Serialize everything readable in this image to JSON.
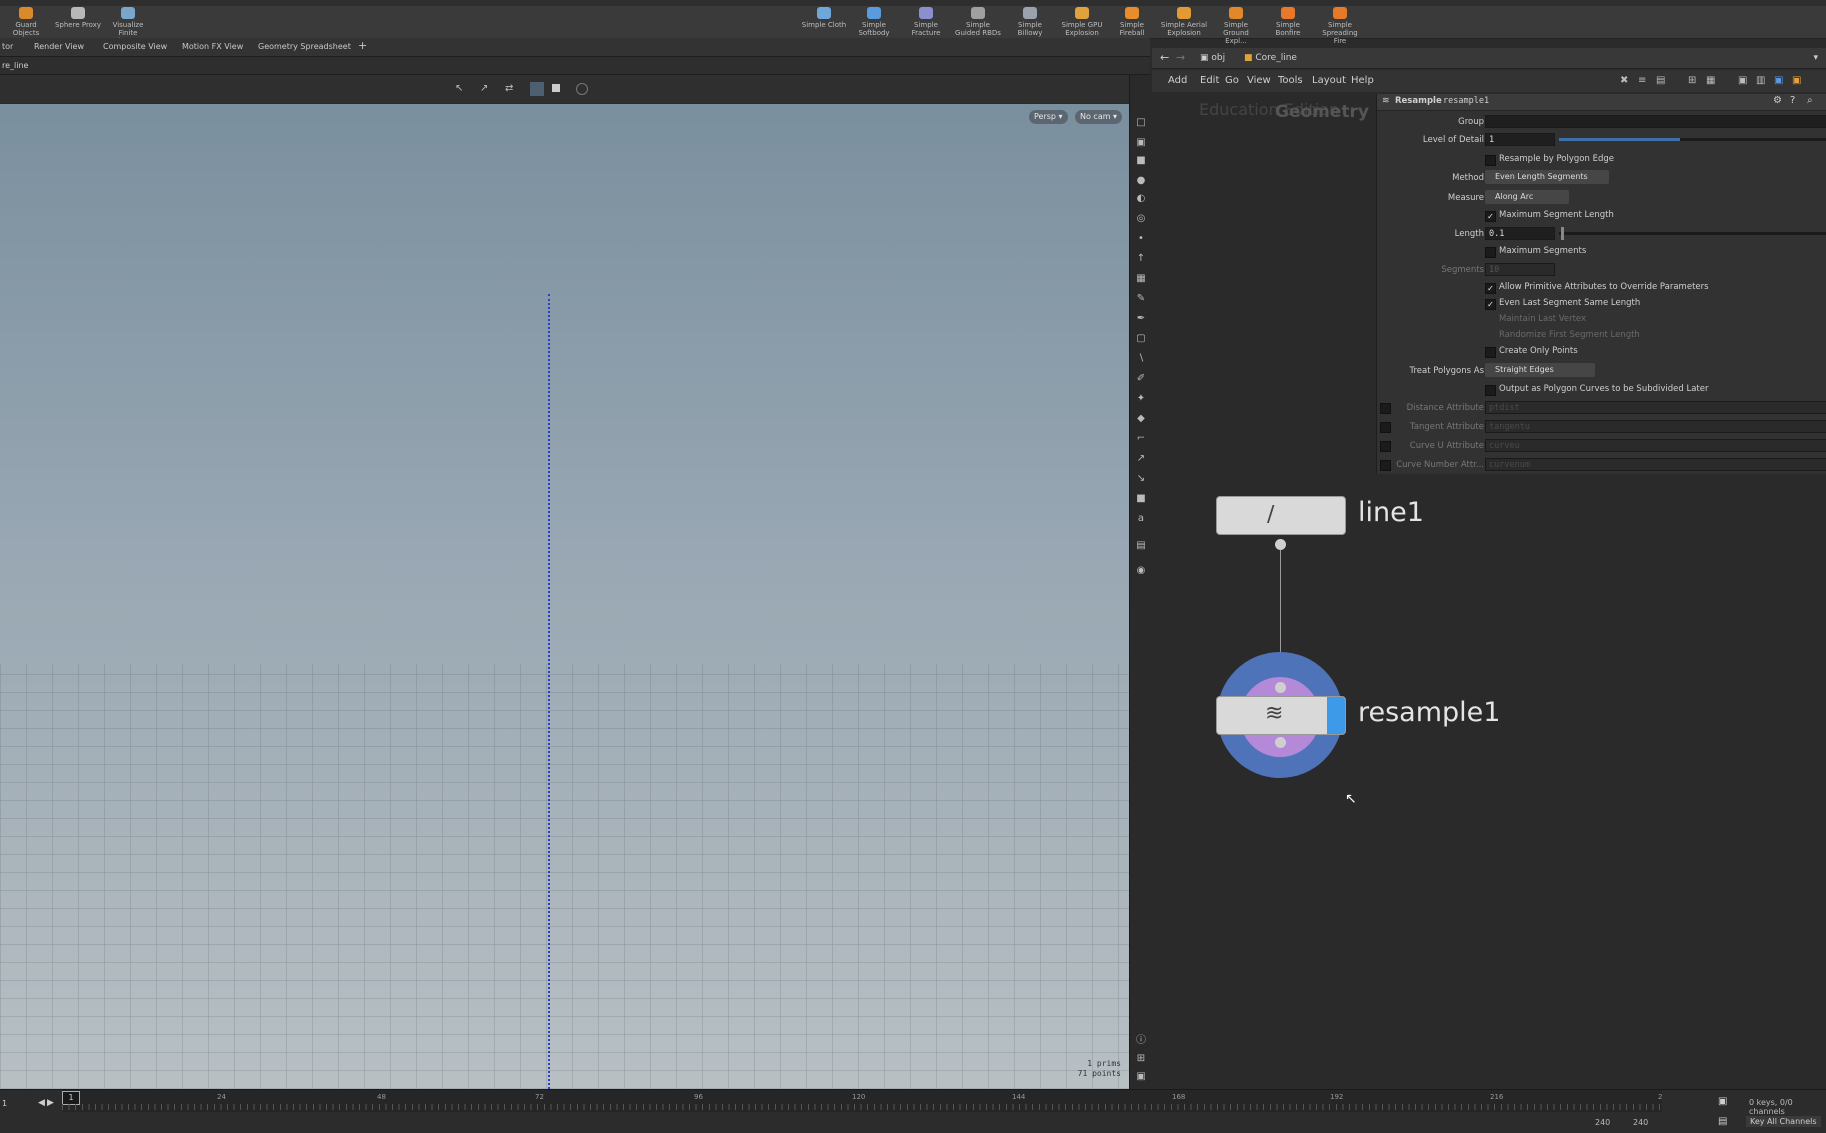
{
  "shelf": {
    "tools_left": [
      "Guard Objects",
      "Sphere Proxy",
      "Visualize Finite Eleme..."
    ],
    "tools_right": [
      "Simple Cloth",
      "Simple Softbody",
      "Simple Fracture",
      "Simple Guided RBDs",
      "Simple Billowy Smo...",
      "Simple GPU Explosion",
      "Simple Fireball",
      "Simple Aerial Explosion",
      "Simple Ground Expl...",
      "Simple Bonfire",
      "Simple Spreading Fire"
    ]
  },
  "pane_tabs": [
    "tor",
    "Render View",
    "Composite View",
    "Motion FX View",
    "Geometry Spreadsheet"
  ],
  "viewport": {
    "path": "re_line",
    "persp_button": "Persp ▾",
    "cam_button": "No cam ▾",
    "stats_prims": "1  prims",
    "stats_points": "71 points"
  },
  "network": {
    "path_obj": "obj",
    "path_node": "Core_line",
    "menu": [
      "Add",
      "Edit",
      "Go",
      "View",
      "Tools",
      "Layout",
      "Help"
    ],
    "watermark_left": "Education Edition",
    "watermark_right": "Geometry",
    "nodes": [
      {
        "name": "line1"
      },
      {
        "name": "resample1"
      }
    ]
  },
  "params": {
    "node_type": "Resample",
    "node_name": "resample1",
    "group_label": "Group",
    "lod_label": "Level of Detail",
    "lod_value": "1",
    "lod_fraction": 0.45,
    "by_polygon_edge": "Resample by Polygon Edge",
    "method_label": "Method",
    "method_value": "Even Length Segments",
    "measure_label": "Measure",
    "measure_value": "Along Arc",
    "max_seg_length": "Maximum Segment Length",
    "length_label": "Length",
    "length_value": "0.1",
    "max_segments": "Maximum Segments",
    "segments_label": "Segments",
    "segments_value": "10",
    "allow_prim_attr": "Allow Primitive Attributes to Override Parameters",
    "even_last": "Even Last Segment Same Length",
    "maintain_last": "Maintain Last Vertex",
    "randomize_first": "Randomize First Segment Length",
    "create_only_points": "Create Only Points",
    "treat_label": "Treat Polygons As",
    "treat_value": "Straight Edges",
    "output_subdivided": "Output as Polygon Curves to be Subdivided Later",
    "distance_label": "Distance Attribute",
    "distance_value": "ptdist",
    "tangent_label": "Tangent Attribute",
    "tangent_value": "tangentu",
    "curveu_label": "Curve U Attribute",
    "curveu_value": "curveu",
    "curvenum_label": "Curve Number Attr...",
    "curvenum_value": "curvenum"
  },
  "timeline": {
    "frame_start": "1",
    "current_frame": "1",
    "ticks": [
      "24",
      "48",
      "72",
      "96",
      "120",
      "144",
      "168",
      "192",
      "216",
      "2"
    ],
    "keys_info": "0 keys, 0/0 channels",
    "key_all": "Key All Channels",
    "end_a": "240",
    "end_b": "240"
  }
}
